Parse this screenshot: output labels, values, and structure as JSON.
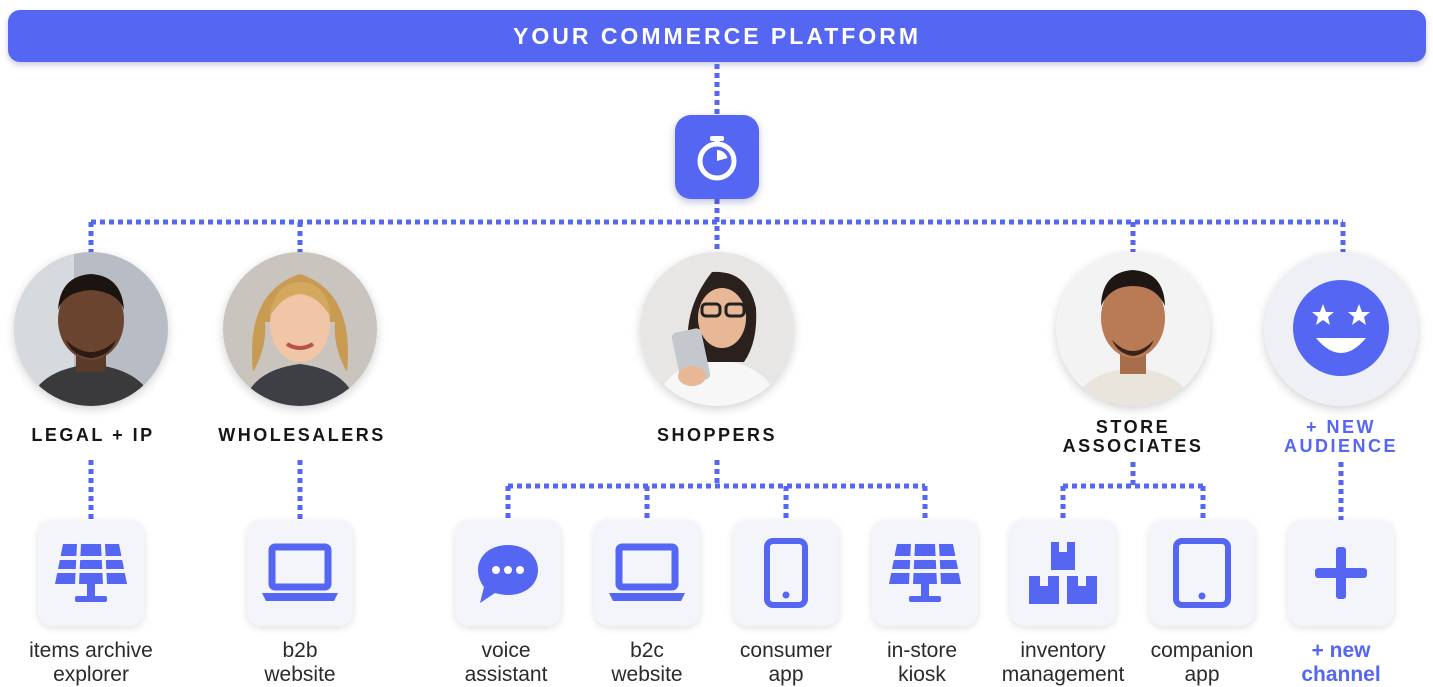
{
  "banner": {
    "title": "YOUR COMMERCE PLATFORM"
  },
  "hub": {
    "icon": "stopwatch-icon"
  },
  "colors": {
    "accent": "#5566f2",
    "tile_bg": "#f4f5fa",
    "text": "#161616"
  },
  "audiences": [
    {
      "name": "legal-ip",
      "label_line1": "LEGAL + IP",
      "label_line2": "",
      "photo": "man-portrait-photo"
    },
    {
      "name": "wholesalers",
      "label_line1": "WHOLESALERS",
      "label_line2": "",
      "photo": "woman-portrait-photo"
    },
    {
      "name": "shoppers",
      "label_line1": "SHOPPERS",
      "label_line2": "",
      "photo": "woman-with-phone-photo"
    },
    {
      "name": "store-associates",
      "label_line1": "STORE",
      "label_line2": "ASSOCIATES",
      "photo": "man-portrait-photo"
    },
    {
      "name": "new-audience",
      "label_line1": "+ NEW",
      "label_line2": "AUDIENCE",
      "icon": "smiley-star-eyes-icon"
    }
  ],
  "channels": [
    {
      "name": "items-archive-explorer",
      "icon": "kiosk-icon",
      "line1": "items archive",
      "line2": "explorer"
    },
    {
      "name": "b2b-website",
      "icon": "laptop-icon",
      "line1": "b2b",
      "line2": "website"
    },
    {
      "name": "voice-assistant",
      "icon": "chat-bubble-icon",
      "line1": "voice",
      "line2": "assistant"
    },
    {
      "name": "b2c-website",
      "icon": "laptop-icon",
      "line1": "b2c",
      "line2": "website"
    },
    {
      "name": "consumer-app",
      "icon": "smartphone-icon",
      "line1": "consumer",
      "line2": "app"
    },
    {
      "name": "in-store-kiosk",
      "icon": "kiosk-icon",
      "line1": "in-store",
      "line2": "kiosk"
    },
    {
      "name": "inventory-management",
      "icon": "boxes-icon",
      "line1": "inventory",
      "line2": "management"
    },
    {
      "name": "companion-app",
      "icon": "tablet-icon",
      "line1": "companion",
      "line2": "app"
    },
    {
      "name": "new-channel",
      "icon": "plus-icon",
      "line1": "+ new",
      "line2": "channel"
    }
  ]
}
